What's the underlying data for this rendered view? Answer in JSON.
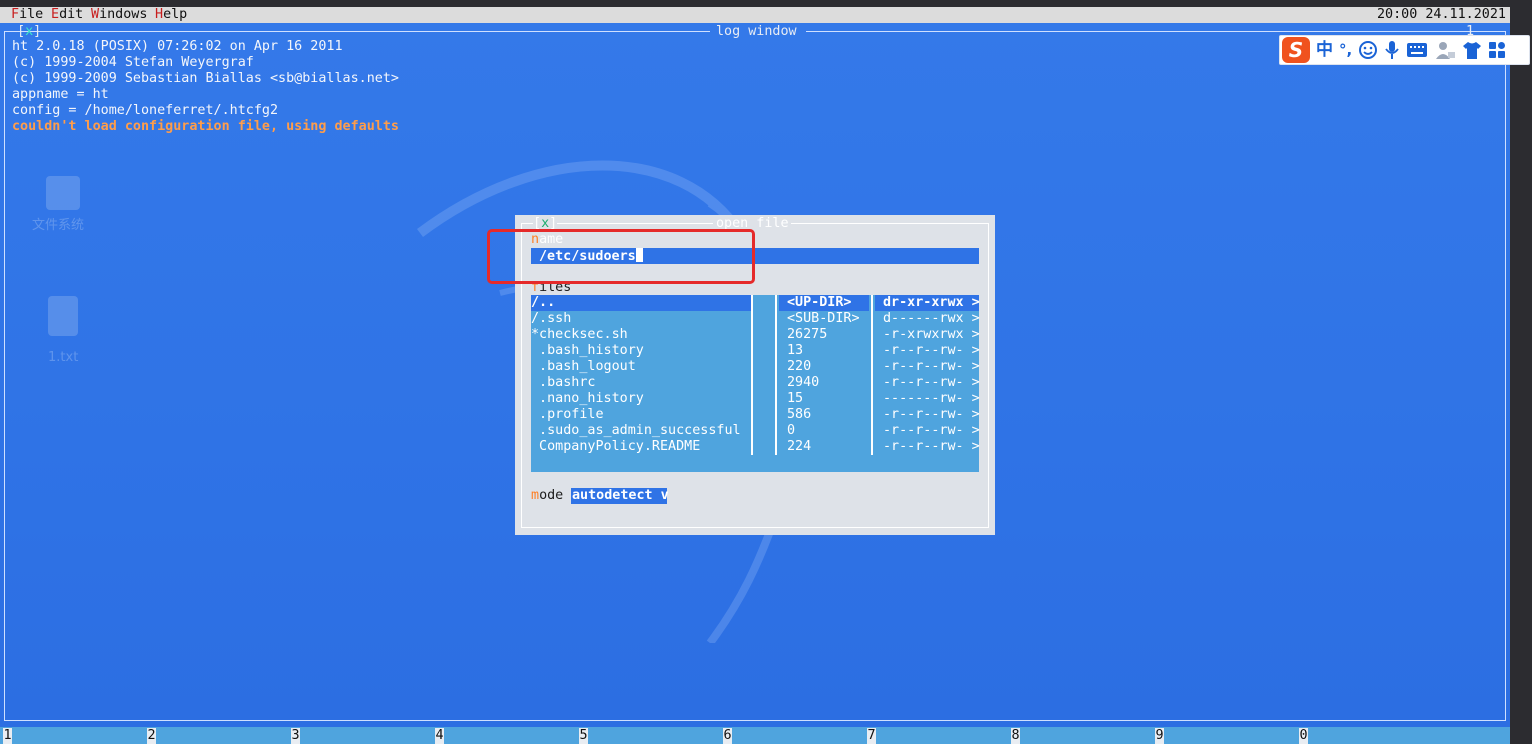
{
  "menubar": {
    "items": [
      {
        "hotkey": "F",
        "rest": "ile"
      },
      {
        "hotkey": "E",
        "rest": "dit"
      },
      {
        "hotkey": "W",
        "rest": "indows"
      },
      {
        "hotkey": "H",
        "rest": "elp"
      }
    ],
    "clock": "20:00 24.11.2021"
  },
  "log_window": {
    "close_marker": "x",
    "title": "log window",
    "window_number": "1",
    "lines": [
      "ht 2.0.18 (POSIX) 07:26:02 on Apr 16 2011",
      "(c) 1999-2004 Stefan Weyergraf",
      "(c) 1999-2009 Sebastian Biallas <sb@biallas.net>",
      "appname = ht",
      "config = /home/loneferret/.htcfg2"
    ],
    "error_line": "couldn't load configuration file, using defaults"
  },
  "desktop_icons": [
    {
      "icon": "file-system-icon",
      "label": "文件系统"
    },
    {
      "icon": "text-file-icon",
      "label": "1.txt"
    }
  ],
  "ime_toolbar": {
    "logo": "S",
    "lang": "中",
    "punct": "°,",
    "icons": [
      "emoji-icon",
      "microphone-icon",
      "keyboard-icon",
      "user-icon",
      "shirt-icon",
      "grid-icon"
    ]
  },
  "open_file_dialog": {
    "close_marker": "x",
    "title": "open file",
    "name_label_hotkey": "n",
    "name_label_rest": "ame",
    "name_value": "/etc/sudoers",
    "files_label_hotkey": "f",
    "files_label_rest": "iles",
    "files": [
      {
        "name": "/..",
        "size": "<UP-DIR>",
        "perm": "dr-xr-xrwx >",
        "selected": true
      },
      {
        "name": "/.ssh",
        "size": "<SUB-DIR>",
        "perm": "d------rwx >"
      },
      {
        "name": "*checksec.sh",
        "size": "26275",
        "perm": "-r-xrwxrwx >"
      },
      {
        "name": " .bash_history",
        "size": "13",
        "perm": "-r--r--rw- >"
      },
      {
        "name": " .bash_logout",
        "size": "220",
        "perm": "-r--r--rw- >"
      },
      {
        "name": " .bashrc",
        "size": "2940",
        "perm": "-r--r--rw- >"
      },
      {
        "name": " .nano_history",
        "size": "15",
        "perm": "-------rw- >"
      },
      {
        "name": " .profile",
        "size": "586",
        "perm": "-r--r--rw- >"
      },
      {
        "name": " .sudo_as_admin_successful",
        "size": "0",
        "perm": "-r--r--rw- >"
      },
      {
        "name": " CompanyPolicy.README",
        "size": "224",
        "perm": "-r--r--rw- >"
      }
    ],
    "mode_label_hotkey": "m",
    "mode_label_rest": "ode",
    "mode_value": "autodetect v"
  },
  "statusbar": {
    "slots": [
      "1",
      "2",
      "3",
      "4",
      "5",
      "6",
      "7",
      "8",
      "9",
      "0"
    ]
  },
  "colors": {
    "desktop_blue": "#2f73e6",
    "hotkey_red": "#c81e1e",
    "hotkey_orange": "#ff7f24",
    "error_orange": "#ff9d4a",
    "highlight_red": "#e52a2a",
    "list_blue": "#4fa4de"
  }
}
